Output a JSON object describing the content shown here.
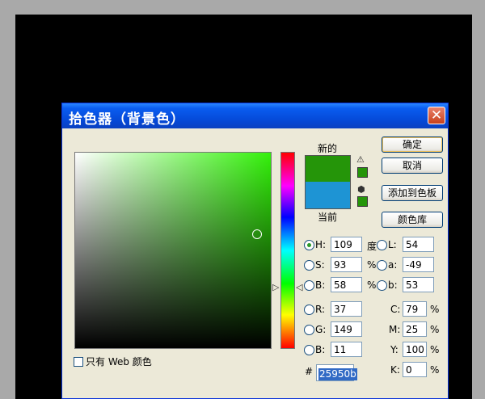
{
  "dialog": {
    "title": "拾色器（背景色）",
    "close_label": "✕",
    "only_web_label": "只有 Web 颜色"
  },
  "swatches": {
    "new_label": "新的",
    "current_label": "当前",
    "new_color": "#259509",
    "current_color": "#1e94d4"
  },
  "buttons": {
    "ok": "确定",
    "cancel": "取消",
    "add_to_swatches": "添加到色板",
    "color_libraries": "颜色库"
  },
  "hsb": {
    "h_label": "H:",
    "h_value": "109",
    "h_unit": "度",
    "s_label": "S:",
    "s_value": "93",
    "s_unit": "%",
    "b_label": "B:",
    "b_value": "58",
    "b_unit": "%"
  },
  "lab": {
    "l_label": "L:",
    "l_value": "54",
    "a_label": "a:",
    "a_value": "-49",
    "b_label": "b:",
    "b_value": "53"
  },
  "rgb": {
    "r_label": "R:",
    "r_value": "37",
    "g_label": "G:",
    "g_value": "149",
    "b_label": "B:",
    "b_value": "11"
  },
  "cmyk": {
    "c_label": "C:",
    "c_value": "79",
    "m_label": "M:",
    "m_value": "25",
    "y_label": "Y:",
    "y_value": "100",
    "k_label": "K:",
    "k_value": "0",
    "unit": "%"
  },
  "hex": {
    "label": "#",
    "value": "25950b"
  },
  "icons": {
    "gamut_warning": "warning-triangle-icon",
    "web_safe": "cube-icon"
  }
}
